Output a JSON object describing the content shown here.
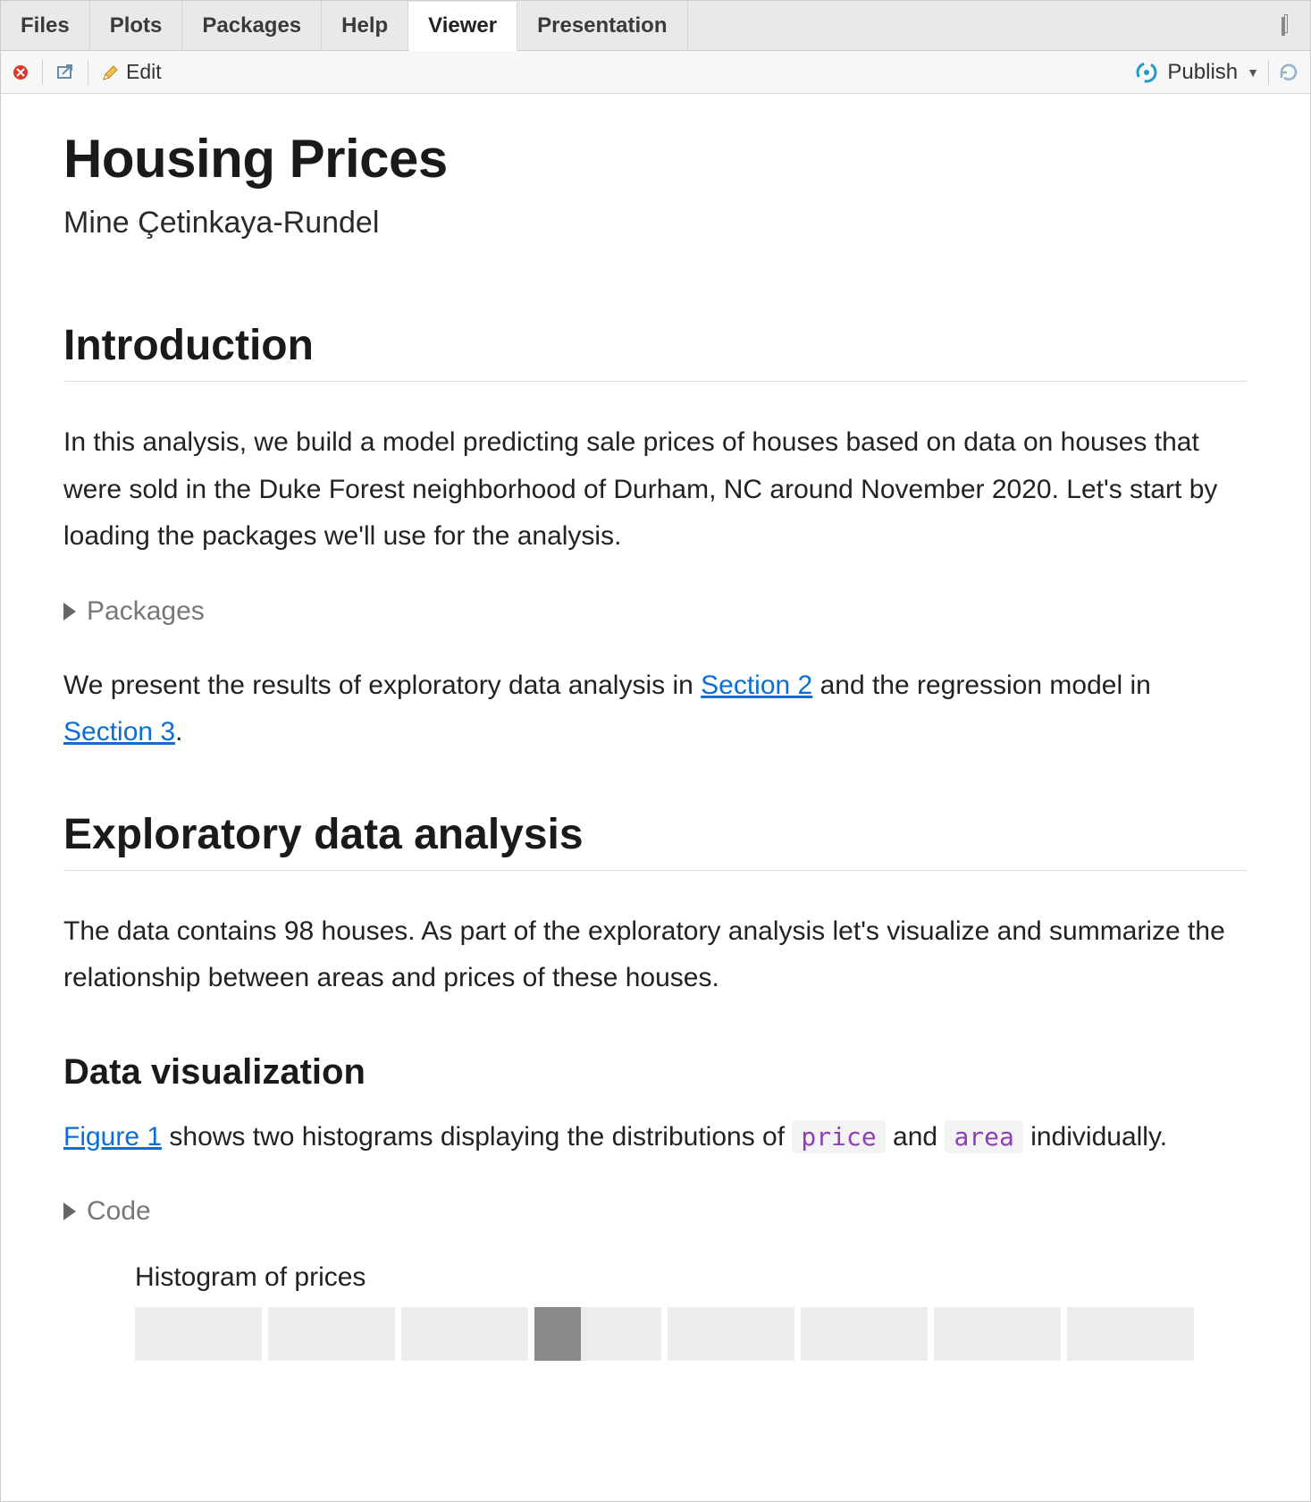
{
  "tabs": {
    "files": "Files",
    "plots": "Plots",
    "packages": "Packages",
    "help": "Help",
    "viewer": "Viewer",
    "presentation": "Presentation"
  },
  "toolbar": {
    "edit_label": "Edit",
    "publish_label": "Publish"
  },
  "doc": {
    "title": "Housing Prices",
    "author": "Mine Çetinkaya-Rundel",
    "section_intro": "Introduction",
    "intro_p1": "In this analysis, we build a model predicting sale prices of houses based on data on houses that were sold in the Duke Forest neighborhood of Durham, NC around November 2020. Let's start by loading the packages we'll use for the analysis.",
    "fold_packages": "Packages",
    "intro_p2_a": "We present the results of exploratory data analysis in ",
    "intro_p2_link1": "Section 2",
    "intro_p2_b": " and the regression model in ",
    "intro_p2_link2": "Section 3",
    "intro_p2_c": ".",
    "section_eda": "Exploratory data analysis",
    "eda_p1": "The data contains 98 houses. As part of the exploratory analysis let's visualize and summarize the relationship between areas and prices of these houses.",
    "subsection_viz": "Data visualization",
    "viz_link1": "Figure 1",
    "viz_p1_a": " shows two histograms displaying the distributions of ",
    "viz_code1": "price",
    "viz_p1_b": " and ",
    "viz_code2": "area",
    "viz_p1_c": " individually.",
    "fold_code": "Code",
    "fig_title": "Histogram of prices"
  }
}
